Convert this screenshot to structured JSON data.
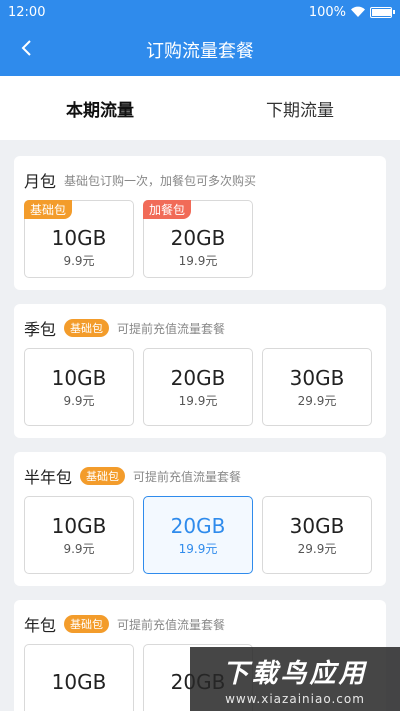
{
  "status": {
    "time": "12:00",
    "battery": "100%",
    "battery_level": 1.0
  },
  "nav": {
    "title": "订购流量套餐"
  },
  "tabs": [
    {
      "label": "本期流量",
      "active": true
    },
    {
      "label": "下期流量",
      "active": false
    }
  ],
  "sections": [
    {
      "title": "月包",
      "note": "基础包订购一次，加餐包可多次购买",
      "cards": [
        {
          "size": "10GB",
          "price": "9.9元",
          "tag": "基础包"
        },
        {
          "size": "20GB",
          "price": "19.9元",
          "tag": "加餐包"
        }
      ]
    },
    {
      "title": "季包",
      "badge": "基础包",
      "note": "可提前充值流量套餐",
      "cards": [
        {
          "size": "10GB",
          "price": "9.9元"
        },
        {
          "size": "20GB",
          "price": "19.9元"
        },
        {
          "size": "30GB",
          "price": "29.9元"
        }
      ]
    },
    {
      "title": "半年包",
      "badge": "基础包",
      "note": "可提前充值流量套餐",
      "cards": [
        {
          "size": "10GB",
          "price": "9.9元"
        },
        {
          "size": "20GB",
          "price": "19.9元",
          "selected": true
        },
        {
          "size": "30GB",
          "price": "29.9元"
        }
      ]
    },
    {
      "title": "年包",
      "badge": "基础包",
      "note": "可提前充值流量套餐",
      "cards": [
        {
          "size": "10GB",
          "price": ""
        },
        {
          "size": "20GB",
          "price": ""
        }
      ]
    }
  ],
  "watermark": {
    "main": "下载鸟应用",
    "sub": "www.xiazainiao.com"
  },
  "colors": {
    "primary": "#2f8bec",
    "badge_orange": "#f39c2b",
    "badge_red": "#f16b58"
  }
}
